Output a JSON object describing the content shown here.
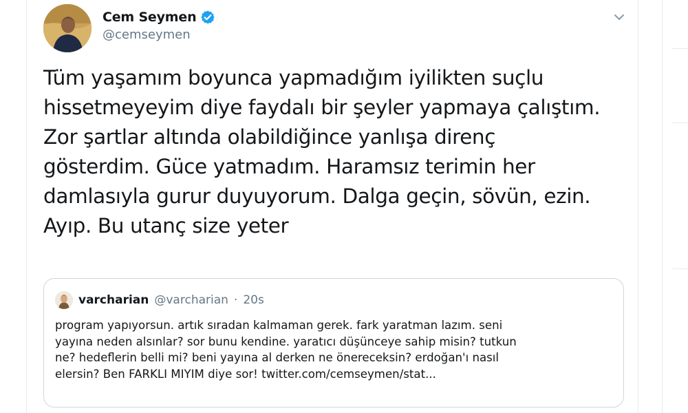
{
  "tweet": {
    "author": {
      "display_name": "Cem Seymen",
      "handle": "@cemseymen",
      "verified": true,
      "verified_color": "#1da1f2"
    },
    "text": "Tüm yaşamım boyunca yapmadığım iyilikten suçlu\nhissetmeyeyim diye faydalı bir şeyler yapmaya çalıştım.\nZor şartlar altında olabildiğince yanlışa direnç\ngösterdim. Güce yatmadım. Haramsız terimin her\ndamlasıyla gurur duyuyorum. Dalga geçin, sövün, ezin.\nAyıp. Bu utanç size yeter",
    "menu_icon": "chevron-down-icon"
  },
  "quoted_tweet": {
    "display_name": "varcharian",
    "handle": "@varcharian",
    "separator": "·",
    "time": "20s",
    "text": "program yapıyorsun. artık sıradan kalmaman gerek. fark yaratman lazım. seni\nyayına neden alsınlar? sor bunu kendine. yaratıcı düşünceye sahip misin? tutkun\nne? hedeflerin belli mi? beni yayına al derken ne önereceksin? erdoğan'ı nasıl\nelersin? Ben FARKLI MIYIM diye sor! twitter.com/cemseymen/stat..."
  },
  "colors": {
    "text_primary": "#14171a",
    "text_secondary": "#657786",
    "border": "#ccd6dd",
    "divider": "#e6ecf0"
  }
}
